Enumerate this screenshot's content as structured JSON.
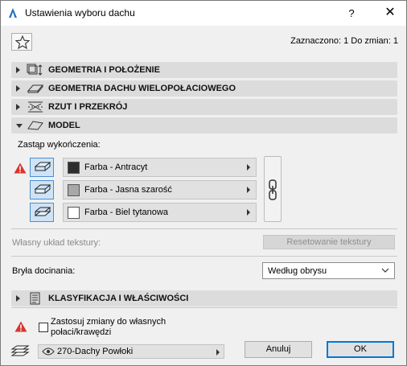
{
  "window": {
    "title": "Ustawienia wyboru dachu",
    "help": "?",
    "close": "✕"
  },
  "toolbar": {
    "selection_info": "Zaznaczono: 1 Do zmian: 1"
  },
  "sections": [
    {
      "label": "GEOMETRIA I POŁOŻENIE",
      "expanded": false
    },
    {
      "label": "GEOMETRIA DACHU WIELOPOŁACIOWEGO",
      "expanded": false
    },
    {
      "label": "RZUT I PRZEKRÓJ",
      "expanded": false
    },
    {
      "label": "MODEL",
      "expanded": true
    },
    {
      "label": "KLASYFIKACJA I WŁAŚCIWOŚCI",
      "expanded": false
    }
  ],
  "model": {
    "override_label": "Zastąp wykończenia:",
    "paints": [
      {
        "name": "Farba - Antracyt",
        "color": "#2e2e2e"
      },
      {
        "name": "Farba - Jasna szarość",
        "color": "#a8a8a8"
      },
      {
        "name": "Farba - Biel tytanowa",
        "color": "#ffffff"
      }
    ],
    "texture_label": "Własny układ tekstury:",
    "texture_reset": "Resetowanie tekstury",
    "trim_label": "Bryła docinania:",
    "trim_value": "Według obrysu"
  },
  "footer": {
    "apply_text": "Zastosuj zmiany do własnych połaci/krawędzi",
    "layer": "270-Dachy Powłoki",
    "cancel": "Anuluj",
    "ok": "OK"
  },
  "colors": {
    "warning": "#d9342b",
    "accent": "#0078d7"
  }
}
